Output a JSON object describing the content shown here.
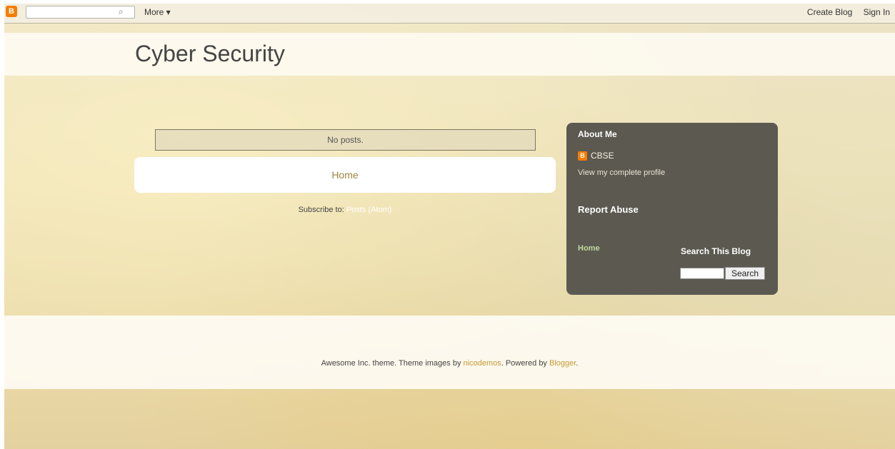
{
  "navbar": {
    "logo_letter": "B",
    "search_icon": "⌕",
    "more_label": "More ▾",
    "create_blog": "Create Blog",
    "sign_in": "Sign In"
  },
  "header": {
    "title": "Cyber Security"
  },
  "main": {
    "no_posts": "No posts.",
    "home_link": "Home",
    "subscribe_label": "Subscribe to:",
    "subscribe_link": "Posts (Atom)"
  },
  "sidebar": {
    "about_heading": "About Me",
    "profile_icon_letter": "B",
    "profile_name": "CBSE",
    "profile_link": "View my complete profile",
    "report_abuse": "Report Abuse",
    "home_link": "Home",
    "search_heading": "Search This Blog",
    "search_button": "Search"
  },
  "footer": {
    "part1": "Awesome Inc. theme. Theme images by ",
    "link1": "nicodemos",
    "part2": ". Powered by ",
    "link2": "Blogger",
    "part3": "."
  },
  "colors": {
    "sidebar_bg": "#5c5951",
    "accent_link": "#c39b36",
    "blogger_orange": "#f57d00"
  }
}
